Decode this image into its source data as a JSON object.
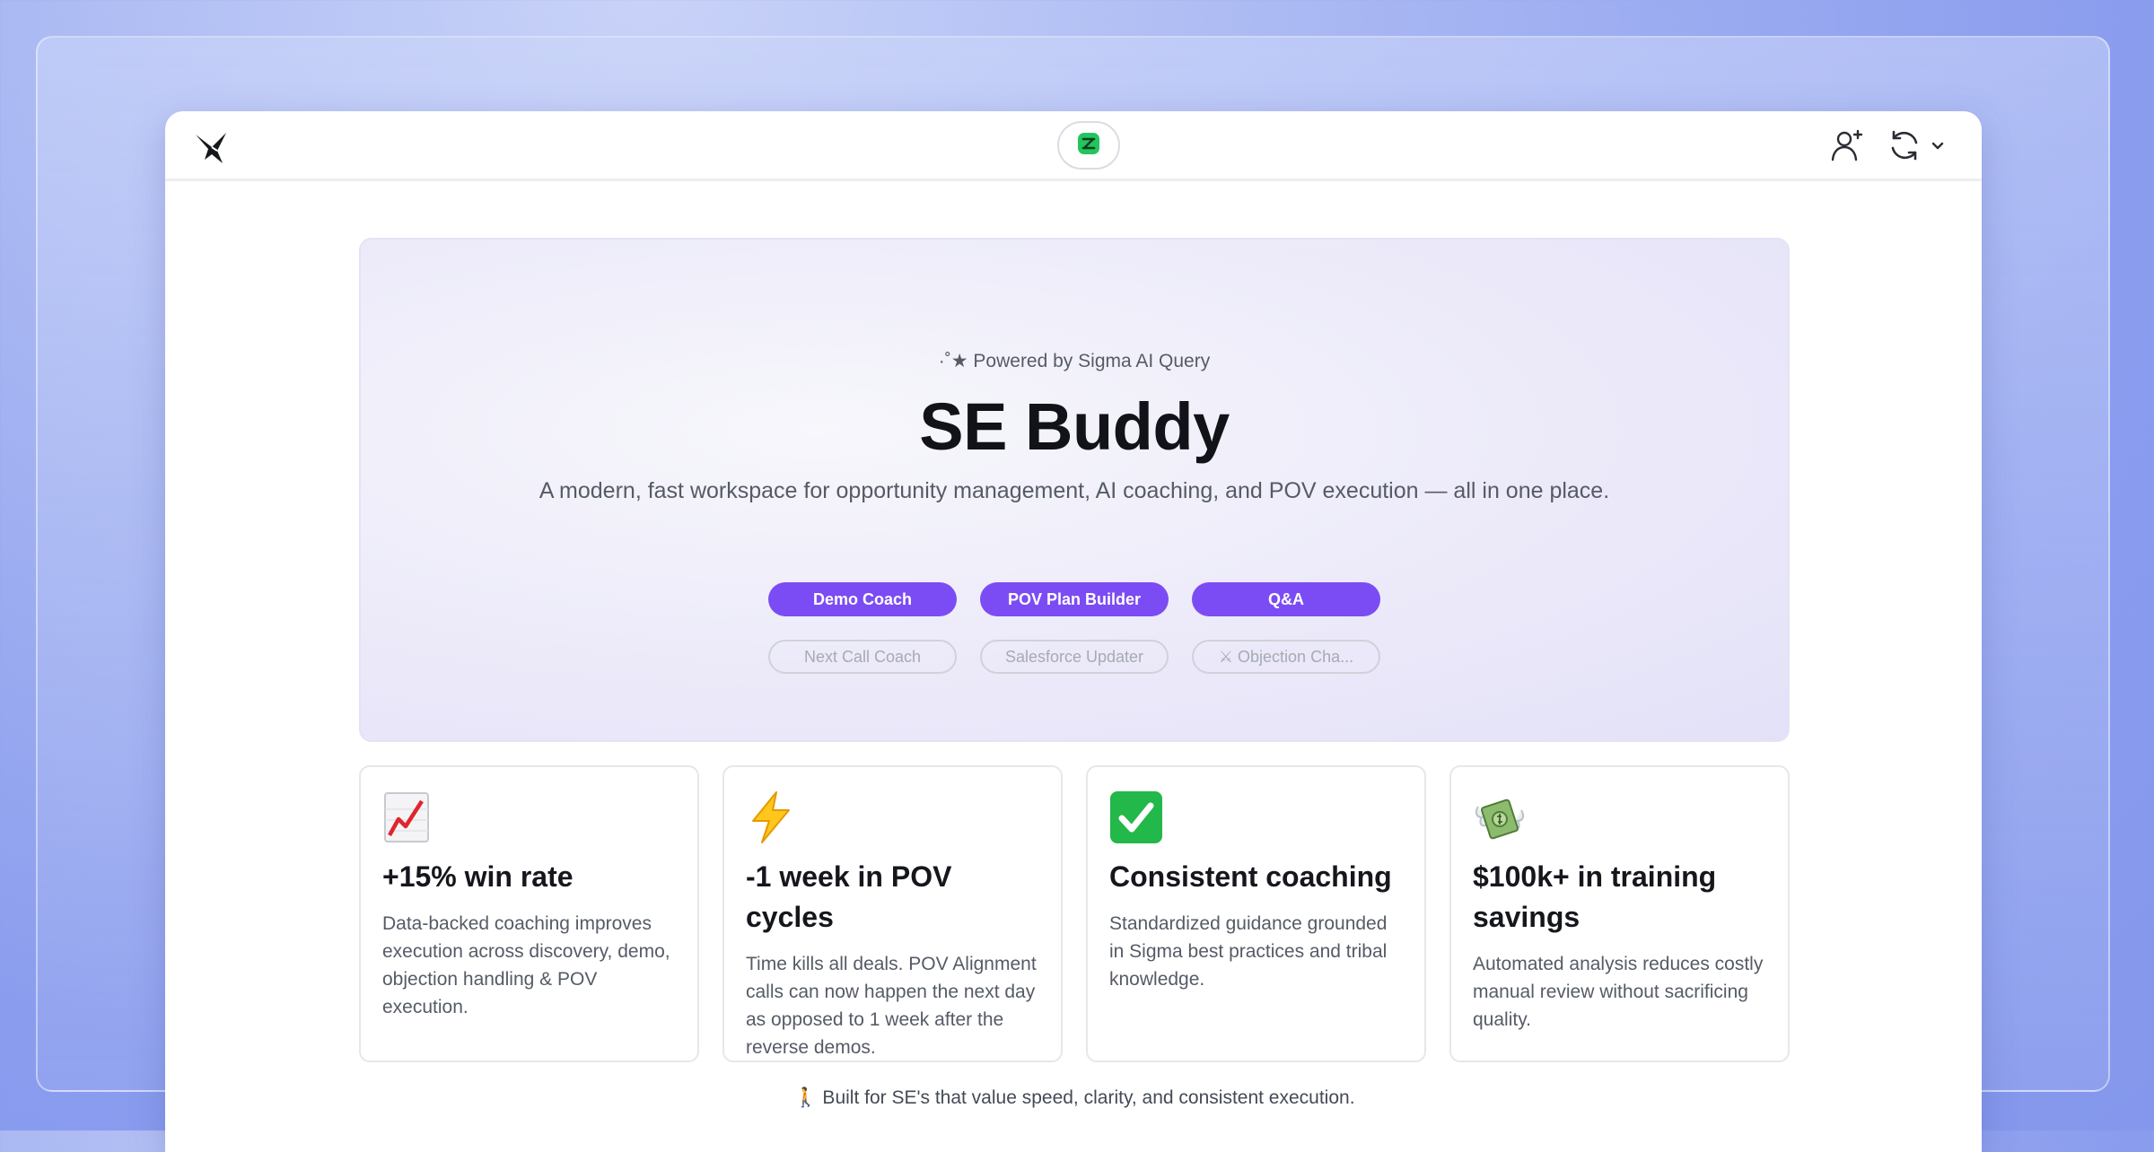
{
  "header": {
    "logo_icon": "bird-logo-icon",
    "center_icon": "sigma-app-icon",
    "add_user_icon": "add-user-icon",
    "sync_icon": "refresh-icon",
    "dropdown_icon": "chevron-down-icon"
  },
  "hero": {
    "powered_by": "·˚★ Powered by Sigma AI Query",
    "title": "SE Buddy",
    "subtitle": "A modern, fast workspace for opportunity management, AI coaching, and POV execution — all in one place.",
    "primary_buttons": [
      "Demo Coach",
      "POV Plan Builder",
      "Q&A"
    ],
    "secondary_buttons": [
      "Next Call Coach",
      "Salesforce Updater",
      "⚔ Objection Cha..."
    ]
  },
  "cards": [
    {
      "icon": "chart-increasing-icon",
      "title": "+15% win rate",
      "text": "Data-backed coaching improves execution across discovery, demo, objection handling & POV execution."
    },
    {
      "icon": "lightning-icon",
      "title": "-1 week in POV cycles",
      "text": "Time kills all deals. POV Alignment calls can now happen the next day as opposed to 1 week after the reverse demos."
    },
    {
      "icon": "check-mark-icon",
      "title": "Consistent coaching",
      "text": "Standardized guidance grounded in Sigma best practices and tribal knowledge."
    },
    {
      "icon": "money-with-wings-icon",
      "title": "$100k+ in training savings",
      "text": "Automated analysis reduces costly manual review without sacrificing quality."
    }
  ],
  "footer": {
    "text": "🚶 Built for SE's that value speed, clarity, and consistent execution."
  },
  "colors": {
    "accent": "#7b4cf3",
    "brand_green": "#22c55e",
    "background": "#8a9cee"
  }
}
